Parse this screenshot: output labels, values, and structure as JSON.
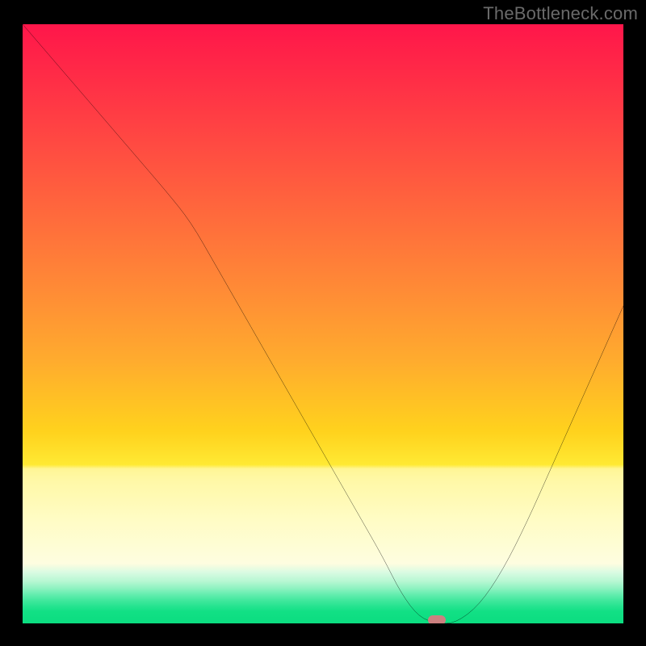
{
  "watermark": "TheBottleneck.com",
  "colors": {
    "frame_bg": "#000000",
    "curve": "#000000",
    "marker": "#d77b7f",
    "gradient_top": "#ff164a",
    "gradient_bottom": "#0bdd80"
  },
  "chart_data": {
    "type": "line",
    "title": "",
    "xlabel": "",
    "ylabel": "",
    "xlim": [
      0,
      100
    ],
    "ylim": [
      0,
      100
    ],
    "note": "x and y are percentages of the plot area; y=100 is top (red, high bottleneck), y=0 is bottom (green, no bottleneck). The curve shows bottleneck severity approaching a minimum near x≈68, rising again toward the right.",
    "series": [
      {
        "name": "bottleneck-curve",
        "x": [
          0,
          6,
          12,
          18,
          24,
          28,
          32,
          36,
          40,
          44,
          48,
          52,
          56,
          60,
          63,
          66,
          69,
          72,
          76,
          80,
          84,
          88,
          92,
          96,
          100
        ],
        "y": [
          100,
          93,
          86,
          79,
          72,
          67,
          60,
          53,
          46,
          39,
          32,
          25,
          18,
          11,
          5,
          1,
          0,
          0,
          3,
          9,
          17,
          26,
          35,
          44,
          53
        ]
      }
    ],
    "marker": {
      "name": "optimal-point",
      "x": 69,
      "y": 0.5
    }
  }
}
